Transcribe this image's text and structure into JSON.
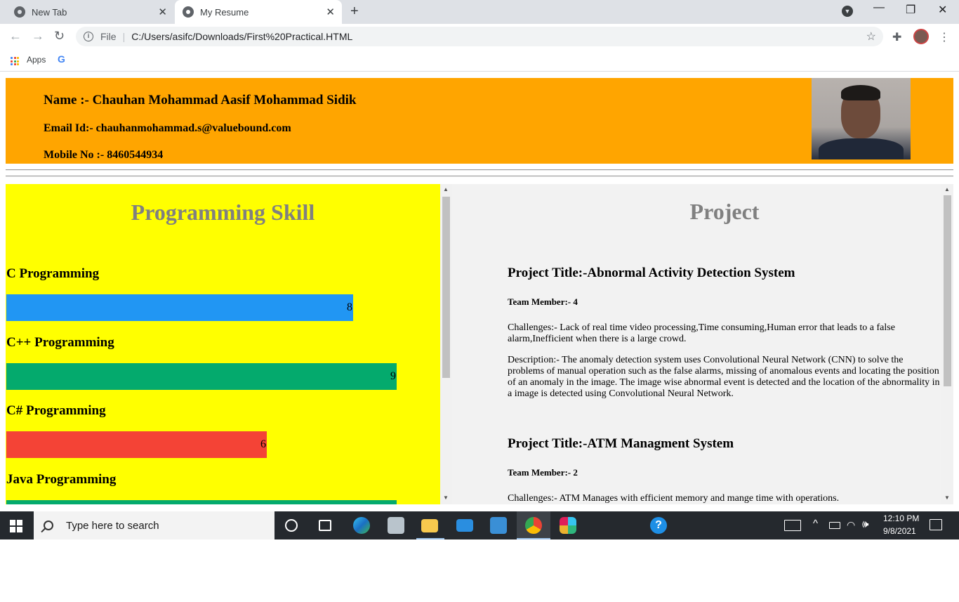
{
  "browser": {
    "tabs": [
      {
        "title": "New Tab",
        "active": false
      },
      {
        "title": "My Resume",
        "active": true
      }
    ],
    "address": {
      "scheme": "File",
      "url": "C:/Users/asifc/Downloads/First%20Practical.HTML"
    },
    "bookmarks": {
      "apps_label": "Apps",
      "google_icon": "google-g-icon"
    }
  },
  "header": {
    "name": "Name :- Chauhan Mohammad Aasif Mohammad Sidik",
    "email": "Email Id:- chauhanmohammad.s@valuebound.com",
    "mobile": "Mobile No :- 8460544934",
    "background_color": "#ffa500"
  },
  "skills": {
    "title": "Programming Skill",
    "background_color": "#ffff00",
    "items": [
      {
        "name": "C Programming",
        "value": "8",
        "level": 0.8,
        "color": "#2196f3"
      },
      {
        "name": "C++ Programming",
        "value": "9",
        "level": 0.9,
        "color": "#04aa6d"
      },
      {
        "name": "C# Programming",
        "value": "6",
        "level": 0.6,
        "color": "#f44336"
      },
      {
        "name": "Java Programming",
        "value": "9",
        "level": 0.9,
        "color": "#04aa6d"
      }
    ]
  },
  "projects": {
    "title": "Project",
    "items": [
      {
        "title": "Project Title:-Abnormal Activity Detection System",
        "team": "Team Member:- 4",
        "challenges": "Challenges:- Lack of real time video processing,Time consuming,Human error that leads to a false alarm,Inefficient when there is a large crowd.",
        "description": "Description:- The anomaly detection system uses Convolutional Neural Network (CNN) to solve the problems of manual operation such as the false alarms, missing of anomalous events and locating the position of an anomaly in the image. The image wise abnormal event is detected and the location of the abnormality in a image is detected using Convolutional Neural Network."
      },
      {
        "title": "Project Title:-ATM Managment System",
        "team": "Team Member:- 2",
        "challenges": "Challenges:- ATM Manages with efficient memory and mange time with operations."
      }
    ]
  },
  "taskbar": {
    "search_placeholder": "Type here to search",
    "time": "12:10 PM",
    "date": "9/8/2021"
  }
}
